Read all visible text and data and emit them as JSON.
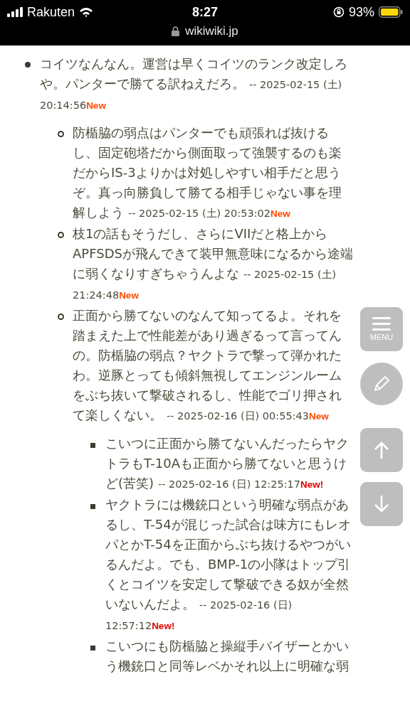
{
  "status_bar": {
    "carrier": "Rakuten",
    "time": "8:27",
    "battery": "93%",
    "url": "wikiwiki.jp"
  },
  "comments": [
    {
      "text": "コイツなんなん。運営は早くコイツのランク改定しろや。パンターで勝てる訳ねえだろ。",
      "date": "-- 2025-02-15 (土) 20:14:56",
      "badge": {
        "text": "New",
        "color": "#ff4b00"
      },
      "children": [
        {
          "text": "防楯脇の弱点はパンターでも頑張れば抜けるし、固定砲塔だから側面取って強襲するのも楽だからIS-3よりかは対処しやすい相手だと思うぞ。真っ向勝負して勝てる相手じゃない事を理解しよう",
          "date": "-- 2025-02-15 (土) 20:53:02",
          "badge": {
            "text": "New",
            "color": "#ff4b00"
          }
        },
        {
          "text": "枝1の話もそうだし、さらにVIIだと格上からAPFSDSが飛んできて装甲無意味になるから途端に弱くなりすぎちゃうんよな",
          "date": "-- 2025-02-15 (土) 21:24:48",
          "badge": {
            "text": "New",
            "color": "#ff4b00"
          }
        },
        {
          "text": "正面から勝てないのなんて知ってるよ。それを踏まえた上で性能差があり過ぎるって言ってんの。防楯脇の弱点？ヤクトラで撃って弾かれたわ。逆豚とっても傾斜無視してエンジンルームをぶち抜いて撃破されるし、性能でゴリ押されて楽しくない。",
          "date": "-- 2025-02-16 (日) 00:55:43",
          "badge": {
            "text": "New",
            "color": "#ff4b00"
          },
          "children": [
            {
              "text": "こいつに正面から勝てないんだったらヤクトラもT-10Aも正面から勝てないと思うけど(苦笑)",
              "date": "-- 2025-02-16 (日) 12:25:17",
              "badge": {
                "text": "New!",
                "color": "#dd0000"
              }
            },
            {
              "text": "ヤクトラには機銃口という明確な弱点があるし、T-54が混じった試合は味方にもレオパとかT-54を正面からぶち抜けるやつがいるんだよ。でも、BMP-1の小隊はトップ引くとコイツを安定して撃破できる奴が全然いないんだよ。",
              "date": "-- 2025-02-16 (日) 12:57:12",
              "badge": {
                "text": "New!",
                "color": "#dd0000"
              }
            },
            {
              "text": "こいつにも防楯脇と操縦手バイザーとかいう機銃口と同等レベかそれ以上に明確な弱"
            }
          ]
        }
      ]
    }
  ],
  "float_buttons": {
    "menu_label": "MENU"
  }
}
